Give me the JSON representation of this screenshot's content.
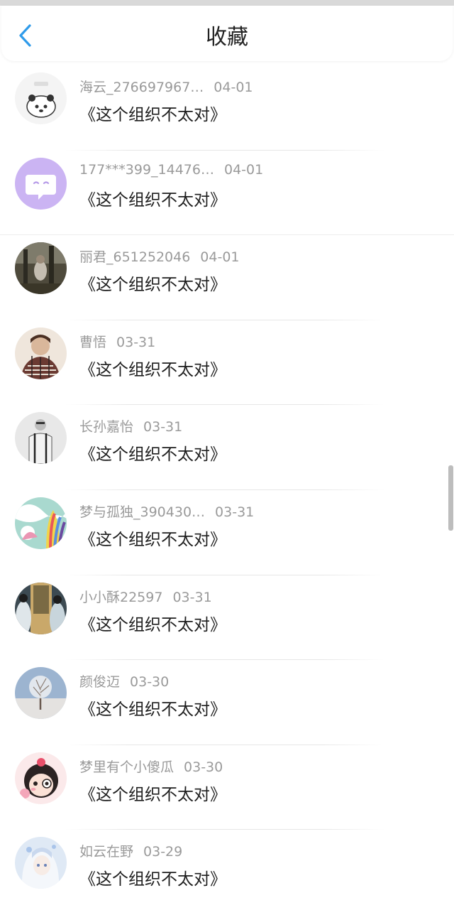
{
  "header": {
    "title": "收藏",
    "back_icon": "chevron-left-icon",
    "accent_color": "#2f9bea"
  },
  "favorites": [
    {
      "user": "海云_276697967…",
      "date": "04-01",
      "book": "《这个组织不太对》",
      "avatar": "panda-cartoon-avatar"
    },
    {
      "user": "177***399_14476…",
      "date": "04-01",
      "book": "《这个组织不太对》",
      "avatar": "default-chat-avatar"
    },
    {
      "user": "丽君_651252046",
      "date": "04-01",
      "book": "《这个组织不太对》",
      "avatar": "photo-avatar"
    },
    {
      "user": "曹悟",
      "date": "03-31",
      "book": "《这个组织不太对》",
      "avatar": "photo-avatar"
    },
    {
      "user": "长孙嘉怡",
      "date": "03-31",
      "book": "《这个组织不太对》",
      "avatar": "photo-avatar"
    },
    {
      "user": "梦与孤独_390430…",
      "date": "03-31",
      "book": "《这个组织不太对》",
      "avatar": "illustration-avatar"
    },
    {
      "user": "小小酥22597",
      "date": "03-31",
      "book": "《这个组织不太对》",
      "avatar": "photo-avatar"
    },
    {
      "user": "颜俊迈",
      "date": "03-30",
      "book": "《这个组织不太对》",
      "avatar": "snow-tree-avatar"
    },
    {
      "user": "梦里有个小傻瓜",
      "date": "03-30",
      "book": "《这个组织不太对》",
      "avatar": "cartoon-girl-avatar"
    },
    {
      "user": "如云在野",
      "date": "03-29",
      "book": "《这个组织不太对》",
      "avatar": "anime-avatar"
    }
  ]
}
